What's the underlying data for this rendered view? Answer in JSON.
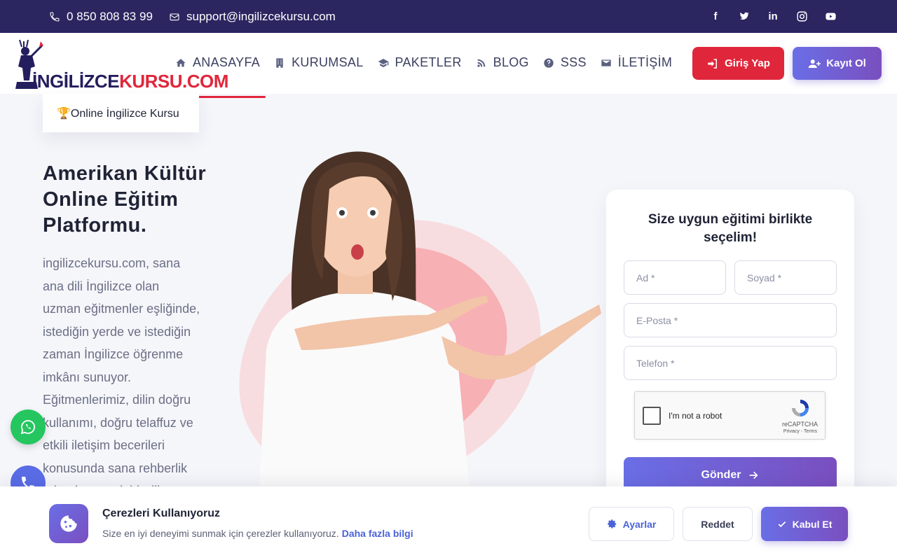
{
  "topbar": {
    "phone": "0 850 808 83 99",
    "email": "support@ingilizcekursu.com",
    "social": [
      "f",
      "t",
      "in",
      "ig",
      "yt"
    ]
  },
  "header": {
    "logo_part1": "İNGİLİZCE",
    "logo_part2": "KURSU.COM",
    "nav": [
      {
        "label": "ANASAYFA",
        "icon": "home-icon"
      },
      {
        "label": "KURUMSAL",
        "icon": "building-icon"
      },
      {
        "label": "PAKETLER",
        "icon": "graduation-cap-icon"
      },
      {
        "label": "BLOG",
        "icon": "rss-icon"
      },
      {
        "label": "SSS",
        "icon": "question-icon"
      },
      {
        "label": "İLETİŞİM",
        "icon": "envelope-icon"
      }
    ],
    "login_label": "Giriş Yap",
    "register_label": "Kayıt Ol"
  },
  "hero": {
    "badge": "🏆Online İngilizce Kursu",
    "title": "Amerikan Kültür Online Eğitim Platformu.",
    "text": "ingilizcekursu.com, sana ana dili İngilizce olan uzman eğitmenler eşliğinde, istediğin yerde ve istediğin zaman İngilizce öğrenme imkânı sunuyor. Eğitmenlerimiz, dilin doğru kullanımı, doğru telaffuz ve etkili iletişim becerileri konusunda sana rehberlik ederek, gerçek bir dil"
  },
  "form": {
    "title": "Size uygun eğitimi birlikte seçelim!",
    "first_name_placeholder": "Ad *",
    "last_name_placeholder": "Soyad *",
    "email_placeholder": "E-Posta *",
    "phone_placeholder": "Telefon *",
    "recaptcha_label": "I'm not a robot",
    "recaptcha_brand": "reCAPTCHA",
    "recaptcha_terms": "Privacy - Terms",
    "submit_label": "Gönder"
  },
  "cookie": {
    "title": "Çerezleri Kullanıyoruz",
    "description": "Size en iyi deneyimi sunmak için çerezler kullanıyoruz.",
    "link": "Daha fazla bilgi",
    "settings_label": "Ayarlar",
    "reject_label": "Reddet",
    "accept_label": "Kabul Et"
  },
  "colors": {
    "topbar": "#2b2560",
    "accent_red": "#e0263b",
    "accent_purple": "#6a6ee6",
    "whatsapp": "#25c660"
  }
}
